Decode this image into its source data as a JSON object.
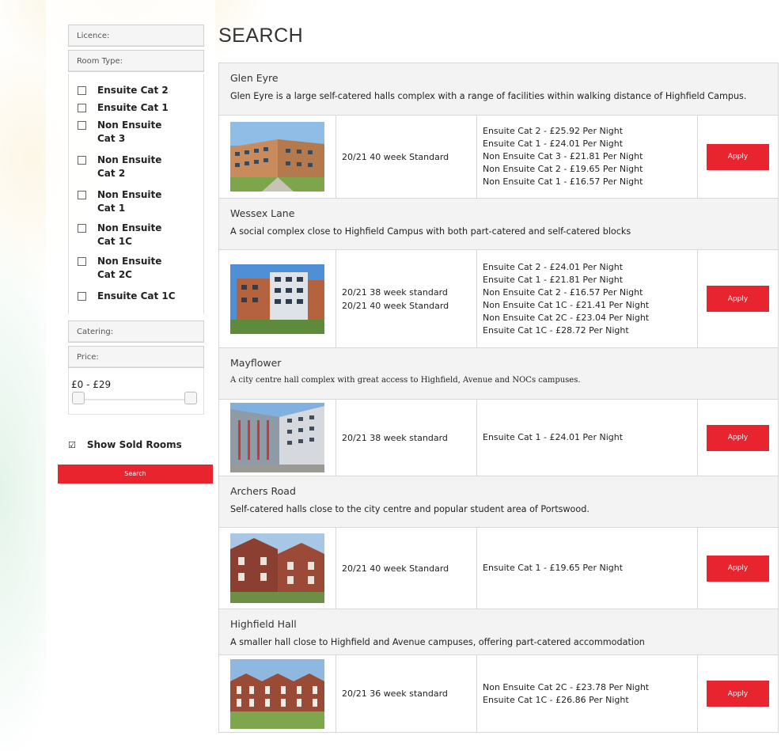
{
  "sidebar": {
    "filters": {
      "licence_label": "Licence:",
      "room_type_label": "Room Type:",
      "catering_label": "Catering:",
      "price_label": "Price:"
    },
    "room_types": [
      {
        "label": "Ensuite Cat 2",
        "checked": false
      },
      {
        "label": "Ensuite Cat 1",
        "checked": false
      },
      {
        "label": "Non Ensuite Cat 3",
        "checked": false
      },
      {
        "label": "Non Ensuite Cat 2",
        "checked": false
      },
      {
        "label": "Non Ensuite Cat 1",
        "checked": false
      },
      {
        "label": "Non Ensuite Cat 1C",
        "checked": false
      },
      {
        "label": "Non Ensuite Cat 2C",
        "checked": false
      },
      {
        "label": "Ensuite Cat 1C",
        "checked": false
      }
    ],
    "price": {
      "range_text": "£0 - £29",
      "min": 0,
      "max": 29
    },
    "show_sold": {
      "label": "Show Sold Rooms",
      "checked": true
    },
    "search_label": "Search"
  },
  "main": {
    "title": "SEARCH",
    "apply_label": "Apply",
    "halls": [
      {
        "name": "Glen Eyre",
        "description": "Glen Eyre is a large self-catered halls complex with a range of facilities within walking distance of Highfield Campus.",
        "terms": [
          "20/21 40 week Standard"
        ],
        "prices": [
          "Ensuite Cat 2 - £25.92 Per Night",
          "Ensuite Cat 1 - £24.01 Per Night",
          "Non Ensuite Cat 3 - £21.81 Per Night",
          "Non Ensuite Cat 2 - £19.65 Per Night",
          "Non Ensuite Cat 1 - £16.57 Per Night"
        ]
      },
      {
        "name": "Wessex Lane",
        "description": "A social complex close to Highfield Campus with both part-catered and self-catered blocks",
        "terms": [
          "20/21 38 week standard",
          "20/21 40 week Standard"
        ],
        "prices": [
          "Ensuite Cat 2 - £24.01 Per Night",
          "Ensuite Cat 1 - £21.81 Per Night",
          "Non Ensuite Cat 2 - £16.57 Per Night",
          "Non Ensuite Cat 1C - £21.41 Per Night",
          "Non Ensuite Cat 2C - £23.04 Per Night",
          "Ensuite Cat 1C - £28.72 Per Night"
        ]
      },
      {
        "name": "Mayflower",
        "description": "A city centre hall complex with great access to Highfield, Avenue and NOCs campuses.",
        "terms": [
          "20/21 38 week standard"
        ],
        "prices": [
          "Ensuite Cat 1 - £24.01 Per Night"
        ]
      },
      {
        "name": "Archers Road",
        "description": "Self-catered halls close to the city centre and popular student area of Portswood.",
        "terms": [
          "20/21 40 week Standard"
        ],
        "prices": [
          "Ensuite Cat 1 - £19.65 Per Night"
        ]
      },
      {
        "name": "Highfield Hall",
        "description": " A smaller hall close to Highfield and Avenue campuses, offering part-catered accommodation",
        "terms": [
          "20/21 36 week standard"
        ],
        "prices": [
          "Non Ensuite Cat 2C - £23.78 Per Night",
          "Ensuite Cat 1C - £26.86 Per Night"
        ]
      }
    ]
  }
}
